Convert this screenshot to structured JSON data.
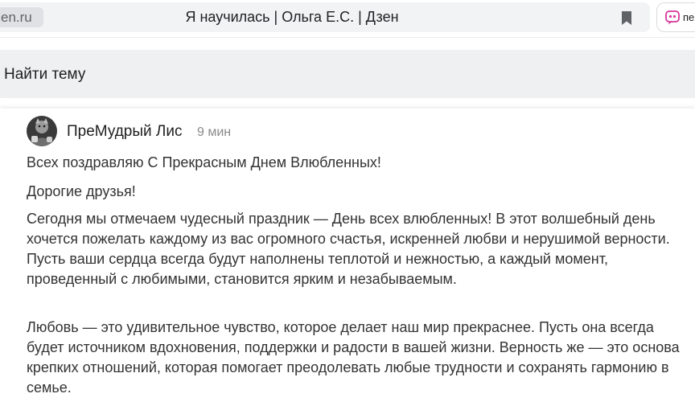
{
  "browser": {
    "domain": "en.ru",
    "title": "Я научилась | Ольга Е.С. | Дзен",
    "bookmark_icon": "bookmark-icon",
    "extension": {
      "label": "пе",
      "icon": "chat-quote-icon",
      "accent": "#d6359a"
    }
  },
  "topic_bar": {
    "label": "Найти тему"
  },
  "post": {
    "author": "ПреМудрый Лис",
    "time": "9 мин",
    "paragraphs": [
      "Всех поздравляю С Прекрасным Днем Влюбленных!",
      "Дорогие друзья!",
      "Сегодня мы отмечаем чудесный праздник — День всех влюбленных! В этот волшебный день хочется пожелать каждому из вас огромного счастья, искренней любви и нерушимой верности. Пусть ваши сердца всегда будут наполнены теплотой и нежностью, а каждый момент, проведенный с любимыми, становится ярким и незабываемым.",
      "Любовь — это удивительное чувство, которое делает наш мир прекраснее. Пусть она всегда будет источником вдохновения, поддержки и радости в вашей жизни. Верность же — это основа крепких отношений, которая помогает преодолевать любые трудности и сохранять гармонию в семье."
    ]
  }
}
